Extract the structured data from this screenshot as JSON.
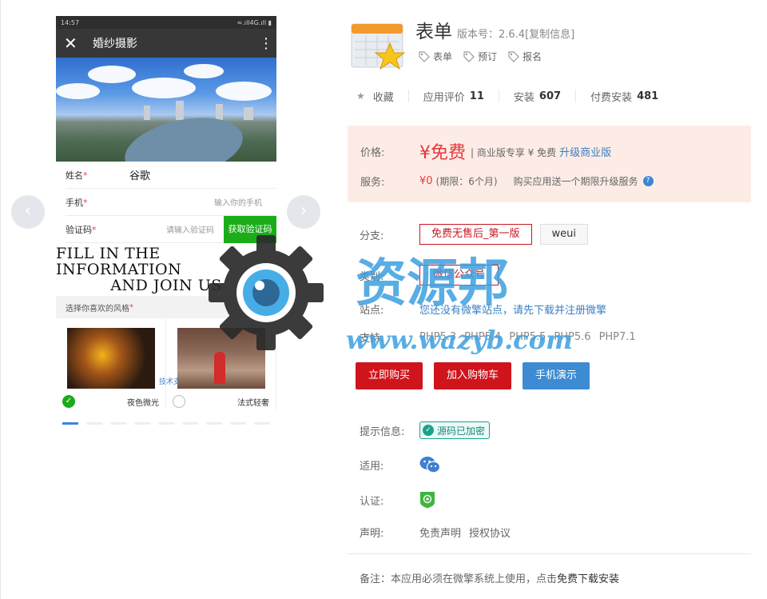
{
  "phone": {
    "status_time": "14:57",
    "status_right": "≈.ıll4G.ıll ▮",
    "title": "婚纱摄影",
    "close_glyph": "✕",
    "more_glyph": "⋮",
    "form": {
      "name_label": "姓名",
      "name_value": "谷歌",
      "phone_label": "手机",
      "phone_placeholder": "输入你的手机",
      "code_label": "验证码",
      "code_placeholder": "请输入验证码",
      "code_button": "获取验证码",
      "required_mark": "*"
    },
    "banner_line1": "FILL IN THE INFORMATION",
    "banner_line2": "AND JOIN US",
    "style_heading": "选择你喜欢的风格",
    "gallery": [
      {
        "label": "夜色微光",
        "selected": true
      },
      {
        "label": "法式轻奢",
        "selected": false
      }
    ],
    "tech_support": "技术支持"
  },
  "carousel": {
    "prev_glyph": "‹",
    "next_glyph": "›",
    "dot_count": 9,
    "active_dot": 0
  },
  "watermark": {
    "cn": "资源邦",
    "url": "www.wazyb.com"
  },
  "app": {
    "title": "表单",
    "version": "版本号：2.6.4[复制信息]",
    "tags": [
      "表单",
      "预订",
      "报名"
    ]
  },
  "stats": {
    "favorite": "收藏",
    "rating_label": "应用评价",
    "rating_value": "11",
    "install_label": "安装",
    "install_value": "607",
    "paid_label": "付费安装",
    "paid_value": "481"
  },
  "pricing": {
    "price_label": "价格:",
    "price": "¥免费",
    "price_note": "| 商业版专享 ¥ 免费",
    "upgrade_link": "升级商业版",
    "service_label": "服务:",
    "service_price": "¥0",
    "service_period": "(期限：6个月)",
    "service_note": "购买应用送一个期限升级服务",
    "help_glyph": "?"
  },
  "branch": {
    "label": "分支:",
    "options": [
      "免费无售后_第一版",
      "weui"
    ],
    "selected": 0
  },
  "category": {
    "label": "类别:",
    "options": [
      "微信公众号"
    ]
  },
  "site": {
    "label": "站点:",
    "text": "您还没有微擎站点，请先下载并注册微擎"
  },
  "support": {
    "label": "支持:",
    "versions": [
      "PHP5.3",
      "PHP5.4",
      "PHP5.5",
      "PHP5.6",
      "PHP7.1"
    ]
  },
  "actions": {
    "buy": "立即购买",
    "cart": "加入购物车",
    "demo": "手机演示"
  },
  "info": {
    "hint_label": "提示信息:",
    "hint_badge": "源码已加密",
    "apply_label": "适用:",
    "cert_label": "认证:",
    "declare_label": "声明:",
    "declare_links": [
      "免责声明",
      "授权协议"
    ]
  },
  "note": {
    "text": "备注：本应用必须在微擎系统上使用，点击",
    "link": "免费下载安装"
  },
  "colors": {
    "accent_red": "#d0141c",
    "price_red": "#e4393c",
    "link_blue": "#3a7fc4",
    "wechat_green": "#1aad19",
    "price_bg": "#fdece6"
  }
}
